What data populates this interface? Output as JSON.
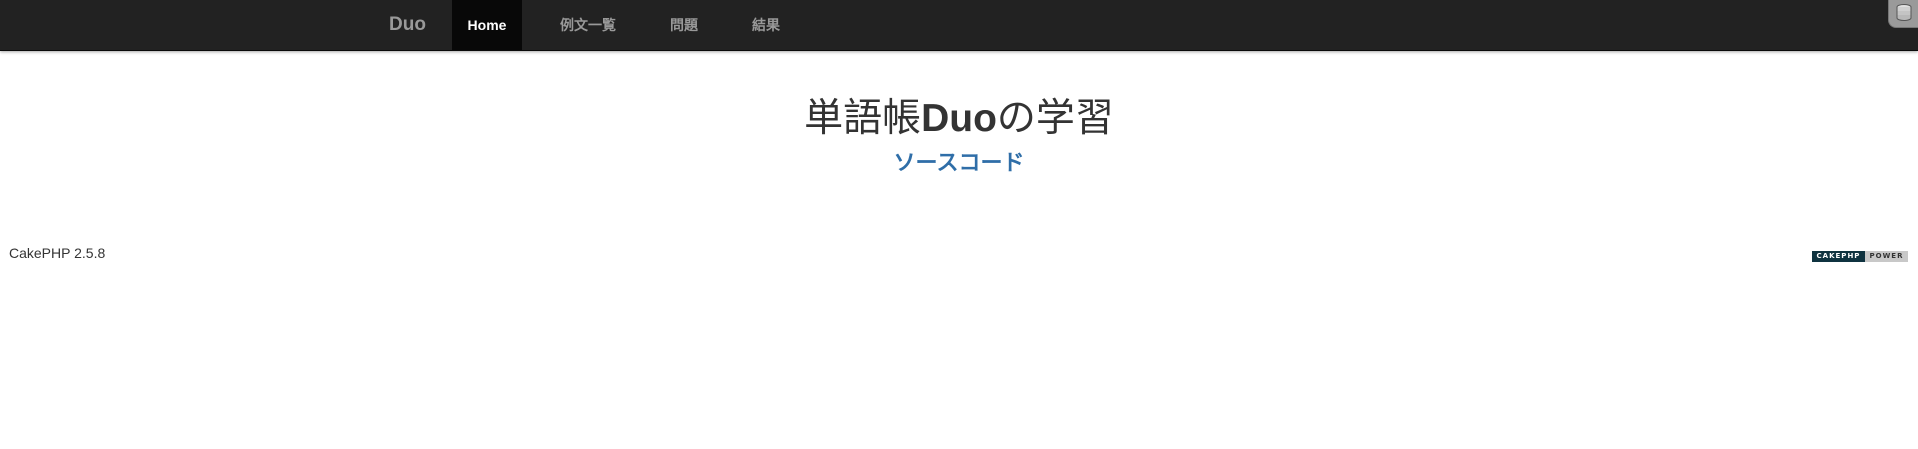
{
  "navbar": {
    "brand": "Duo",
    "items": [
      {
        "label": "Home",
        "active": true
      },
      {
        "label": "例文一覧",
        "active": false
      },
      {
        "label": "問題",
        "active": false
      },
      {
        "label": "結果",
        "active": false
      }
    ]
  },
  "main": {
    "title_prefix": "単語帳",
    "title_strong": "Duo",
    "title_suffix": "の学習",
    "source_link": "ソースコード"
  },
  "footer": {
    "version": "CakePHP 2.5.8",
    "powered_cake": "CAKEPHP",
    "powered_power": "POWER"
  },
  "icons": {
    "debug_toolbar": "database-stack-icon"
  },
  "colors": {
    "navbar_bg": "#222222",
    "active_bg": "#080808",
    "link": "#2f6ea8",
    "text": "#333333"
  }
}
